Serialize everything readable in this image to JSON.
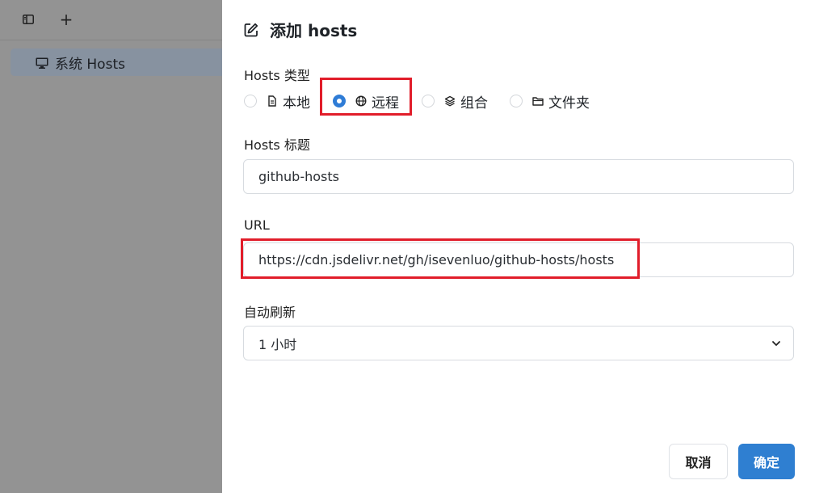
{
  "sidebar": {
    "toolbar": {
      "panel_icon": "sidebar-panel-icon",
      "add_label": "+"
    },
    "items": [
      {
        "label": "系统 Hosts",
        "icon": "monitor-icon"
      }
    ]
  },
  "dialog": {
    "title": "添加 hosts",
    "title_icon": "edit-icon",
    "type_label": "Hosts 类型",
    "types": [
      {
        "label": "本地",
        "icon": "file-icon",
        "selected": false
      },
      {
        "label": "远程",
        "icon": "globe-icon",
        "selected": true
      },
      {
        "label": "组合",
        "icon": "layers-icon",
        "selected": false
      },
      {
        "label": "文件夹",
        "icon": "folder-icon",
        "selected": false
      }
    ],
    "title_field_label": "Hosts 标题",
    "title_value": "github-hosts",
    "url_label": "URL",
    "url_value": "https://cdn.jsdelivr.net/gh/isevenluo/github-hosts/hosts",
    "refresh_label": "自动刷新",
    "refresh_value": "1 小时",
    "cancel_label": "取消",
    "ok_label": "确定"
  },
  "colors": {
    "accent": "#2f7fd1",
    "highlight": "#e11d2a",
    "overlay": "#939393"
  }
}
